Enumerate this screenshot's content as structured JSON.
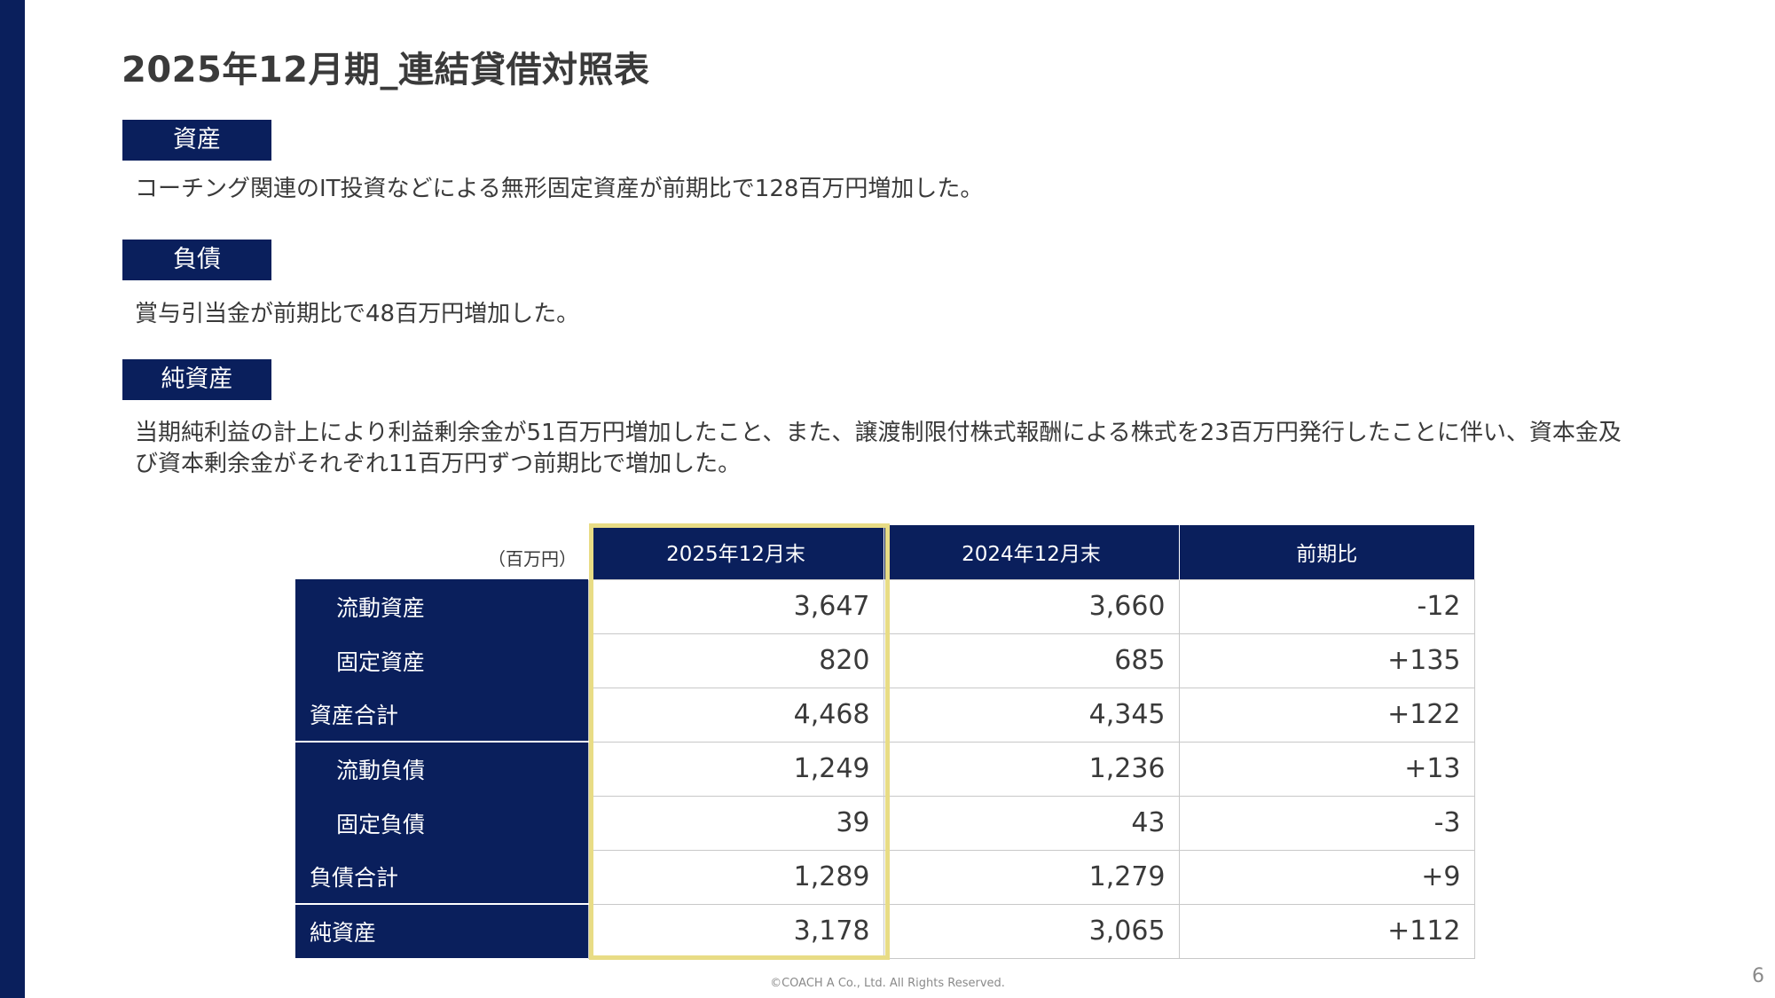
{
  "title": "2025年12月期_連結貸借対照表",
  "sections": [
    {
      "tag": "資産",
      "text": "コーチング関連のIT投資などによる無形固定資産が前期比で128百万円増加した。"
    },
    {
      "tag": "負債",
      "text": "賞与引当金が前期比で48百万円増加した。"
    },
    {
      "tag": "純資産",
      "text": "当期純利益の計上により利益剰余金が51百万円増加したこと、また、譲渡制限付株式報酬による株式を23百万円発行したことに伴い、資本金及び資本剰余金がそれぞれ11百万円ずつ前期比で増加した。"
    }
  ],
  "table": {
    "unit": "（百万円）",
    "columns": [
      "2025年12月末",
      "2024年12月末",
      "前期比"
    ],
    "rows": [
      {
        "label": "流動資産",
        "values": [
          "3,647",
          "3,660",
          "-12"
        ]
      },
      {
        "label": "固定資産",
        "values": [
          "820",
          "685",
          "+135"
        ]
      },
      {
        "label": "資産合計",
        "values": [
          "4,468",
          "4,345",
          "+122"
        ]
      },
      {
        "label": "流動負債",
        "values": [
          "1,249",
          "1,236",
          "+13"
        ]
      },
      {
        "label": "固定負債",
        "values": [
          "39",
          "43",
          "-3"
        ]
      },
      {
        "label": "負債合計",
        "values": [
          "1,289",
          "1,279",
          "+9"
        ]
      },
      {
        "label": "純資産",
        "values": [
          "3,178",
          "3,065",
          "+112"
        ]
      }
    ]
  },
  "footer": "©COACH A Co., Ltd. All Rights Reserved.",
  "page_number": "6",
  "colors": {
    "navy": "#0a1f5c",
    "highlight": "#e8dc85"
  }
}
